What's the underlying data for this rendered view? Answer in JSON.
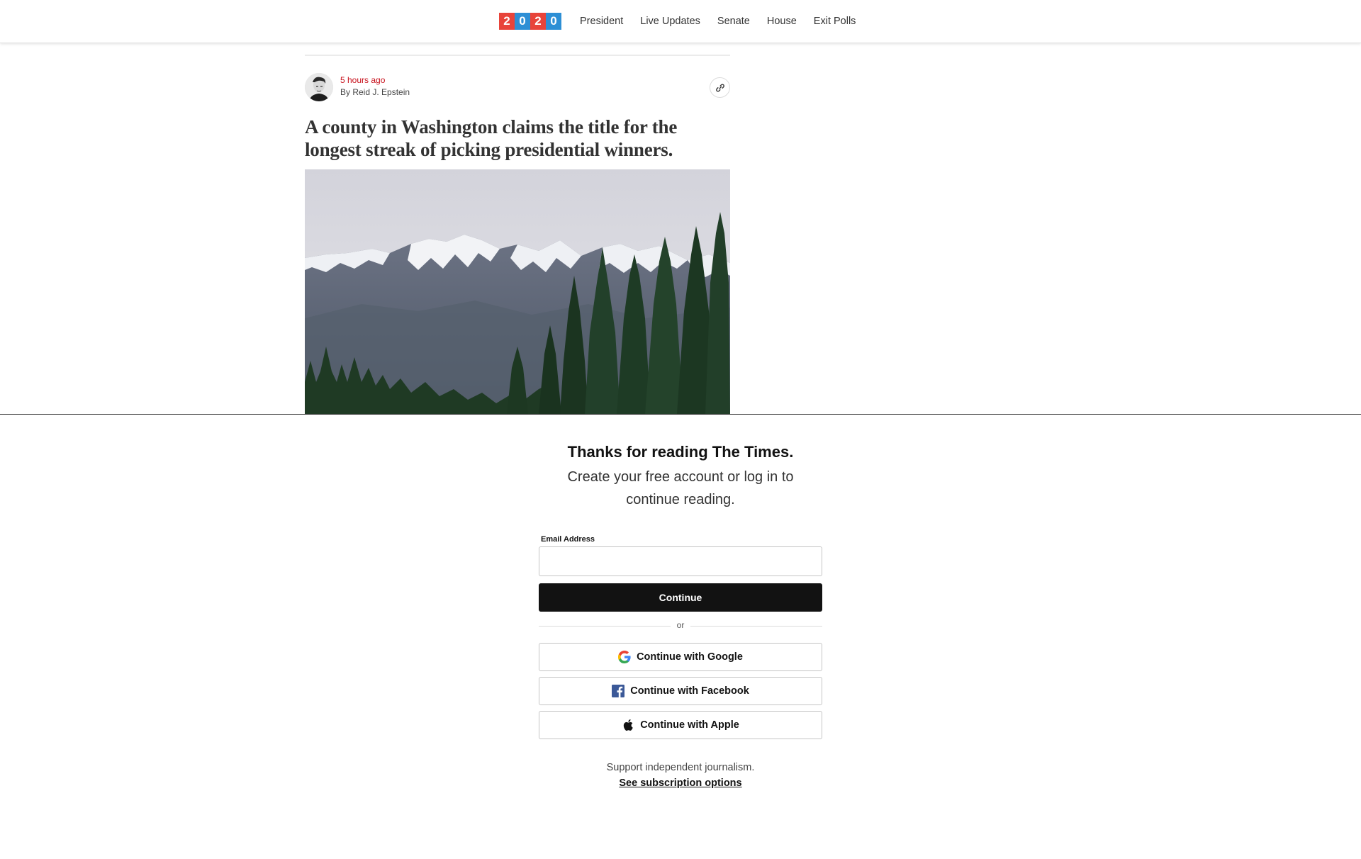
{
  "nav": {
    "logo_digits": [
      "2",
      "0",
      "2",
      "0"
    ],
    "links": [
      "President",
      "Live Updates",
      "Senate",
      "House",
      "Exit Polls"
    ]
  },
  "article": {
    "time_ago": "5 hours ago",
    "byline": "By Reid J. Epstein",
    "headline": "A county in Washington claims the title for the longest streak of picking presidential winners."
  },
  "paywall": {
    "title": "Thanks for reading The Times.",
    "subtitle": "Create your free account or log in to continue reading.",
    "email_label": "Email Address",
    "email_value": "",
    "continue_label": "Continue",
    "or_label": "or",
    "google_label": "Continue with Google",
    "facebook_label": "Continue with Facebook",
    "apple_label": "Continue with Apple",
    "support_text": "Support independent journalism.",
    "subscription_link": "See subscription options"
  },
  "colors": {
    "logo_red": "#e8443a",
    "logo_blue": "#2d8fd5",
    "timestamp_red": "#c70f1a",
    "button_black": "#121212"
  }
}
